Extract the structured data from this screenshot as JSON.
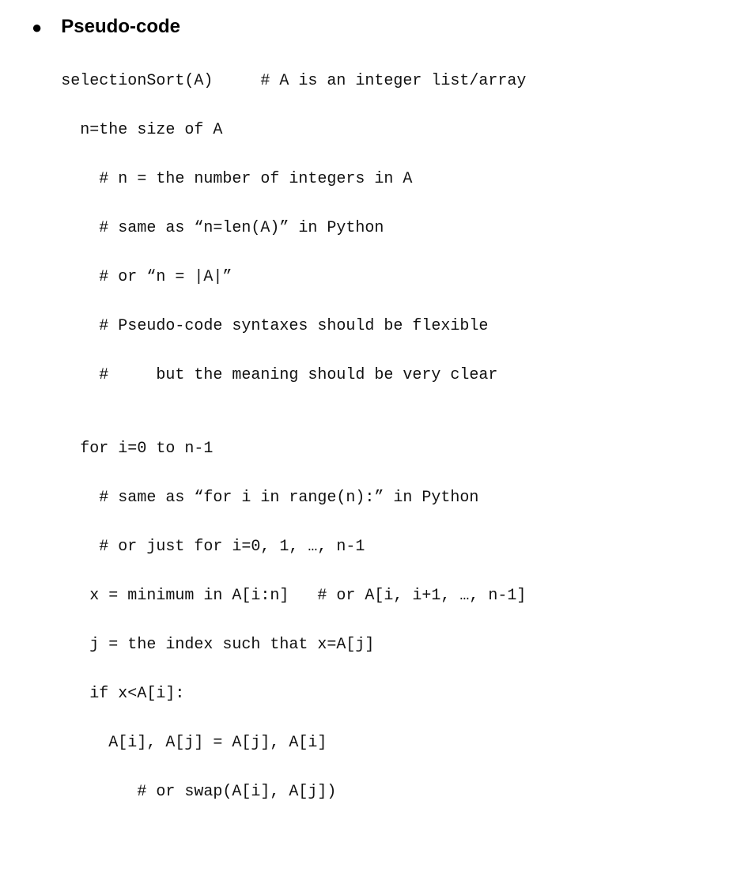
{
  "heading": "Pseudo-code",
  "code_lines": [
    "selectionSort(A)     # A is an integer list/array",
    "  n=the size of A",
    "    # n = the number of integers in A",
    "    # same as “n=len(A)” in Python",
    "    # or “n = |A|”",
    "    # Pseudo-code syntaxes should be flexible",
    "    #     but the meaning should be very clear",
    "",
    "  for i=0 to n-1",
    "    # same as “for i in range(n):” in Python",
    "    # or just for i=0, 1, …, n-1",
    "   x = minimum in A[i:n]   # or A[i, i+1, …, n-1]",
    "   j = the index such that x=A[j]",
    "   if x<A[i]:",
    "     A[i], A[j] = A[j], A[i]",
    "        # or swap(A[i], A[j])"
  ]
}
